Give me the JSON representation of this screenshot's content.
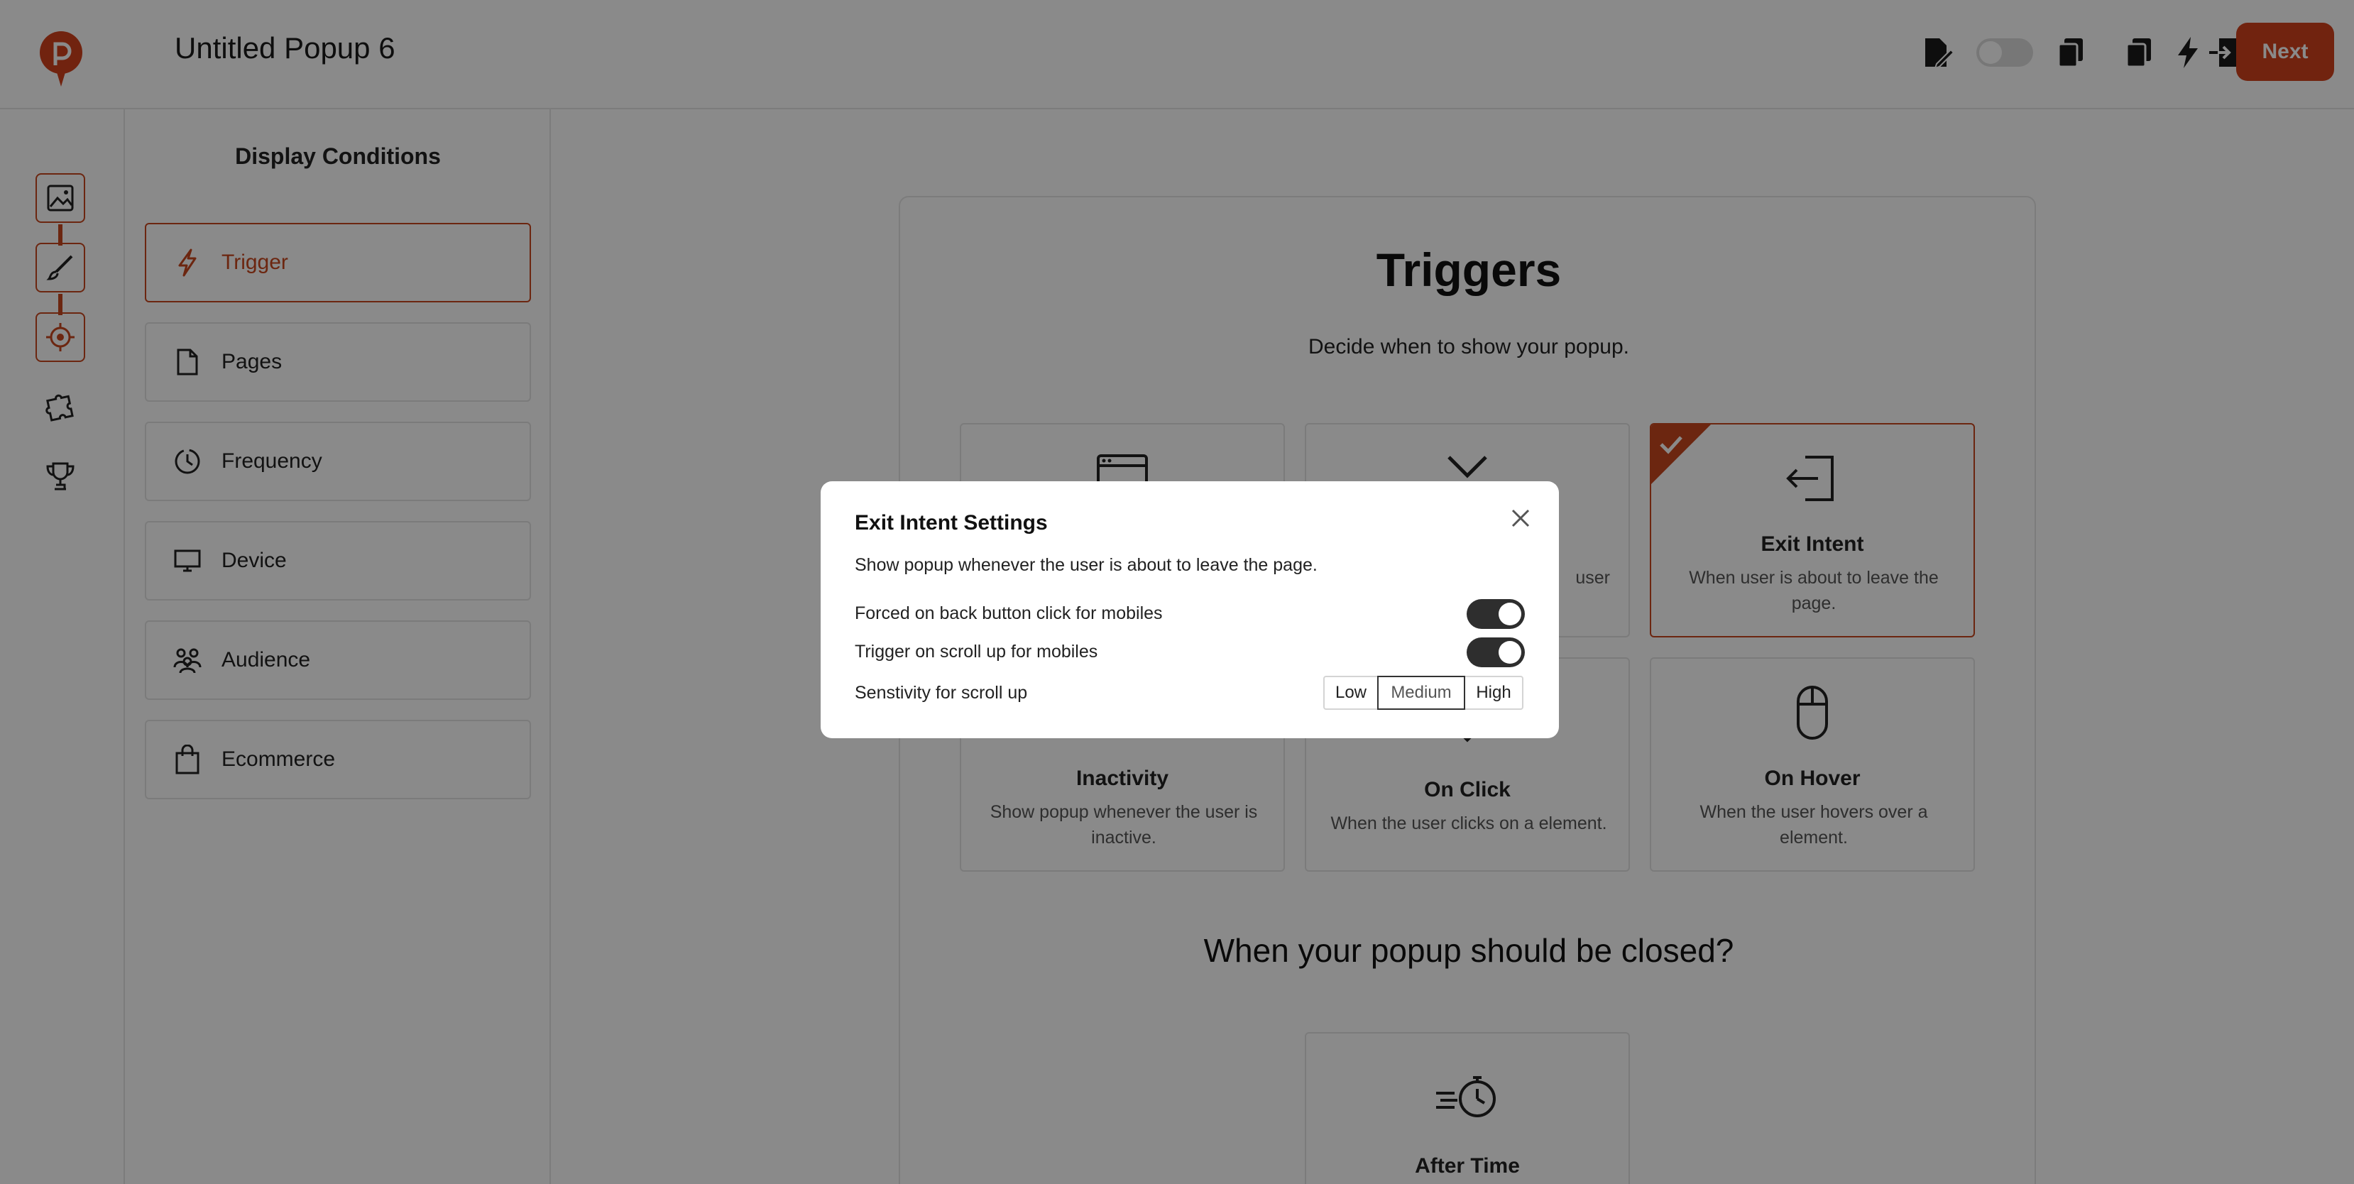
{
  "header": {
    "title": "Untitled Popup 6",
    "next_label": "Next",
    "icons": [
      "edit-doc-icon",
      "status-toggle",
      "copy-icon",
      "duplicate-icon",
      "lightning-icon",
      "exit-icon"
    ]
  },
  "rail": {
    "items": [
      "image-icon",
      "brush-icon",
      "target-icon",
      "puzzle-icon",
      "trophy-icon"
    ]
  },
  "sidebar": {
    "title": "Display Conditions",
    "items": [
      {
        "label": "Trigger",
        "icon": "lightning-icon",
        "active": true
      },
      {
        "label": "Pages",
        "icon": "page-icon",
        "active": false
      },
      {
        "label": "Frequency",
        "icon": "clock-icon",
        "active": false
      },
      {
        "label": "Device",
        "icon": "monitor-icon",
        "active": false
      },
      {
        "label": "Audience",
        "icon": "people-icon",
        "active": false
      },
      {
        "label": "Ecommerce",
        "icon": "bag-icon",
        "active": false
      }
    ]
  },
  "triggers": {
    "title": "Triggers",
    "subtitle": "Decide when to show your popup.",
    "cards": [
      {
        "name": "",
        "desc": "",
        "icon": "browser-window-icon"
      },
      {
        "name": "",
        "desc": "user",
        "icon": "scroll-icon"
      },
      {
        "name": "Exit Intent",
        "desc": "When user is about to leave the page.",
        "icon": "exit-icon",
        "selected": true
      },
      {
        "name": "Inactivity",
        "desc": "Show popup whenever the user is inactive.",
        "icon": "inactivity-icon"
      },
      {
        "name": "On Click",
        "desc": "When the user clicks on a element.",
        "icon": "click-icon"
      },
      {
        "name": "On Hover",
        "desc": "When the user hovers over a element.",
        "icon": "mouse-icon"
      }
    ],
    "close_question": "When your popup should be closed?",
    "close_cards": [
      {
        "name": "After Time",
        "icon": "stopwatch-icon"
      }
    ]
  },
  "modal": {
    "title": "Exit Intent Settings",
    "description": "Show popup whenever the user is about to leave the page.",
    "rows": [
      {
        "label": "Forced on back button click for mobiles",
        "enabled": true
      },
      {
        "label": "Trigger on scroll up for mobiles",
        "enabled": true
      }
    ],
    "sensitivity_label": "Senstivity for scroll up",
    "sensitivity_options": [
      "Low",
      "Medium",
      "High"
    ],
    "sensitivity_selected": "Medium"
  },
  "colors": {
    "accent": "#c8471e",
    "next_button": "#d1411d",
    "overlay": "rgba(0,0,0,0.46)"
  }
}
